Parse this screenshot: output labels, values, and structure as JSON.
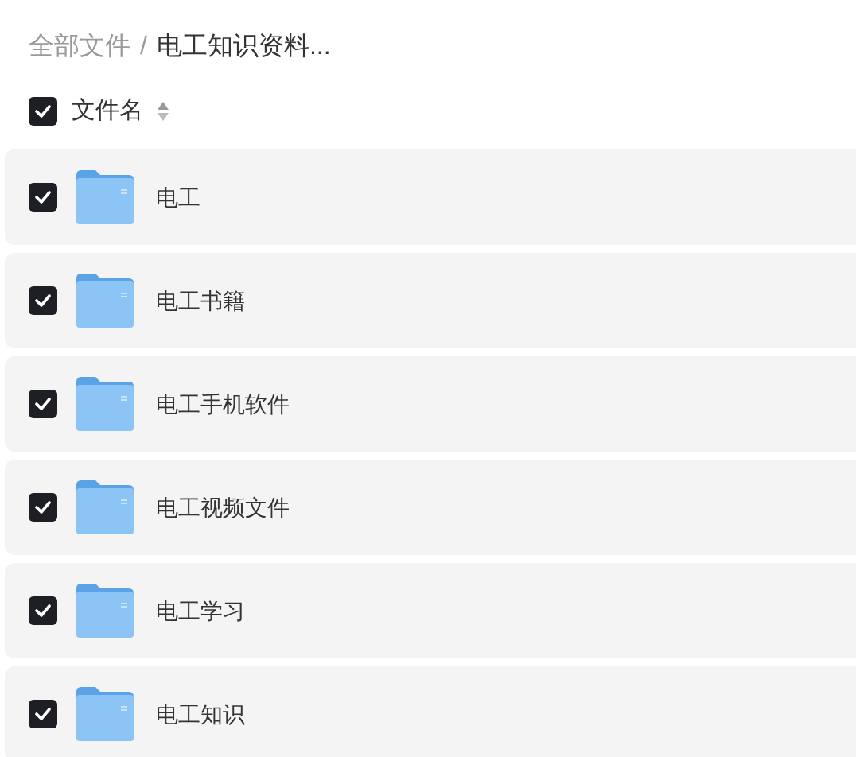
{
  "breadcrumb": [
    {
      "label": "全部文件",
      "selected": false
    },
    {
      "label": "/",
      "selected": false
    },
    {
      "label": "电工知识资料...",
      "selected": true
    }
  ],
  "header": {
    "checked": true,
    "label": "文件名"
  },
  "files": [
    {
      "name": "电工",
      "checked": true
    },
    {
      "name": "电工书籍",
      "checked": true
    },
    {
      "name": "电工手机软件",
      "checked": true
    },
    {
      "name": "电工视频文件",
      "checked": true
    },
    {
      "name": "电工学习",
      "checked": true
    },
    {
      "name": "电工知识",
      "checked": true
    }
  ]
}
